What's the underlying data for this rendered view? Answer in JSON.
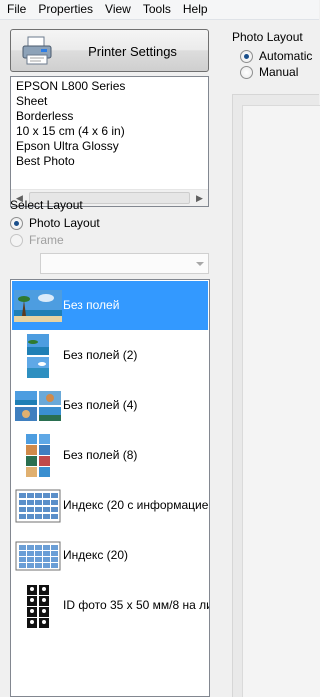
{
  "menu": [
    "File",
    "Properties",
    "View",
    "Tools",
    "Help"
  ],
  "printer_button": {
    "label": "Printer Settings"
  },
  "print_info": [
    "EPSON L800 Series",
    "Sheet",
    "Borderless",
    "10 x 15 cm (4 x 6 in)",
    "Epson Ultra Glossy",
    "Best Photo"
  ],
  "select_layout": {
    "label": "Select Layout",
    "options": [
      {
        "label": "Photo Layout",
        "checked": true,
        "enabled": true
      },
      {
        "label": "Frame",
        "checked": false,
        "enabled": false
      }
    ],
    "frame_value": ""
  },
  "layouts": [
    {
      "label": "Без полей",
      "selected": true,
      "icon": "borderless-photo-icon"
    },
    {
      "label": "Без полей (2)",
      "selected": false,
      "icon": "borderless-2-icon"
    },
    {
      "label": "Без полей (4)",
      "selected": false,
      "icon": "borderless-4-icon"
    },
    {
      "label": "Без полей (8)",
      "selected": false,
      "icon": "borderless-8-icon"
    },
    {
      "label": "Индекс (20 с информацие",
      "selected": false,
      "icon": "index-info-icon"
    },
    {
      "label": "Индекс (20)",
      "selected": false,
      "icon": "index-icon"
    },
    {
      "label": "ID фото 35 x 50 мм/8 на ли",
      "selected": false,
      "icon": "id-photo-icon"
    }
  ],
  "photo_layout_panel": {
    "title": "Photo Layout",
    "options": [
      {
        "label": "Automatic",
        "checked": true
      },
      {
        "label": "Manual",
        "checked": false
      }
    ]
  },
  "colors": {
    "selection": "#3399ff",
    "radio_dot": "#1a4f8b"
  }
}
